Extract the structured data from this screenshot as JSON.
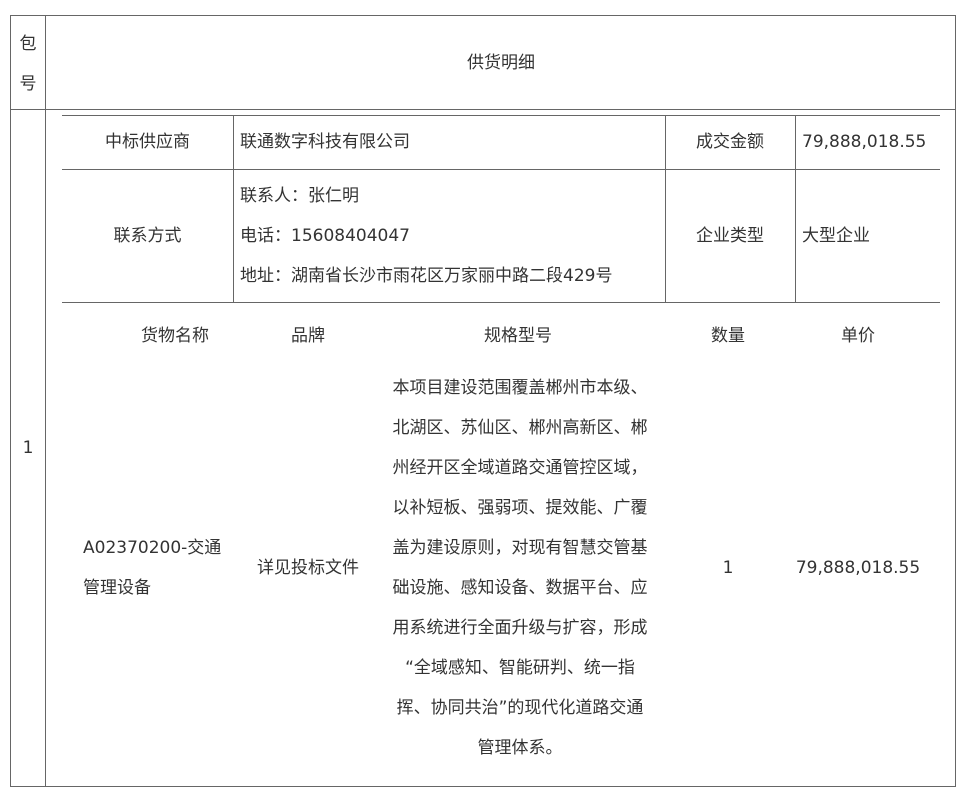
{
  "header": {
    "package_col_label": [
      "包",
      "号"
    ],
    "supply_detail_label": "供货明细"
  },
  "package": {
    "number": "1",
    "supplier_label": "中标供应商",
    "supplier_value": "联通数字科技有限公司",
    "amount_label": "成交金额",
    "amount_value": "79,888,018.55",
    "contact_label": "联系方式",
    "contact_person": "联系人：张仁明",
    "contact_phone": "电话：15608404047",
    "contact_address": "地址：湖南省长沙市雨花区万家丽中路二段429号",
    "enterprise_type_label": "企业类型",
    "enterprise_type_value": "大型企业",
    "goods_columns": {
      "name": "货物名称",
      "brand": "品牌",
      "spec": "规格型号",
      "quantity": "数量",
      "unit_price": "单价"
    },
    "goods_row": {
      "name_lines": [
        "A02370200-交通",
        "管理设备"
      ],
      "brand": "详见投标文件",
      "spec_lines": [
        "本项目建设范围覆盖郴州市本级、",
        "北湖区、苏仙区、郴州高新区、郴",
        "州经开区全域道路交通管控区域，",
        "以补短板、强弱项、提效能、广覆",
        "盖为建设原则，对现有智慧交管基",
        "础设施、感知设备、数据平台、应",
        "用系统进行全面升级与扩容，形成",
        "“全域感知、智能研判、统一指",
        "挥、协同共治”的现代化道路交通",
        "管理体系。"
      ],
      "quantity": "1",
      "unit_price": "79,888,018.55"
    }
  }
}
